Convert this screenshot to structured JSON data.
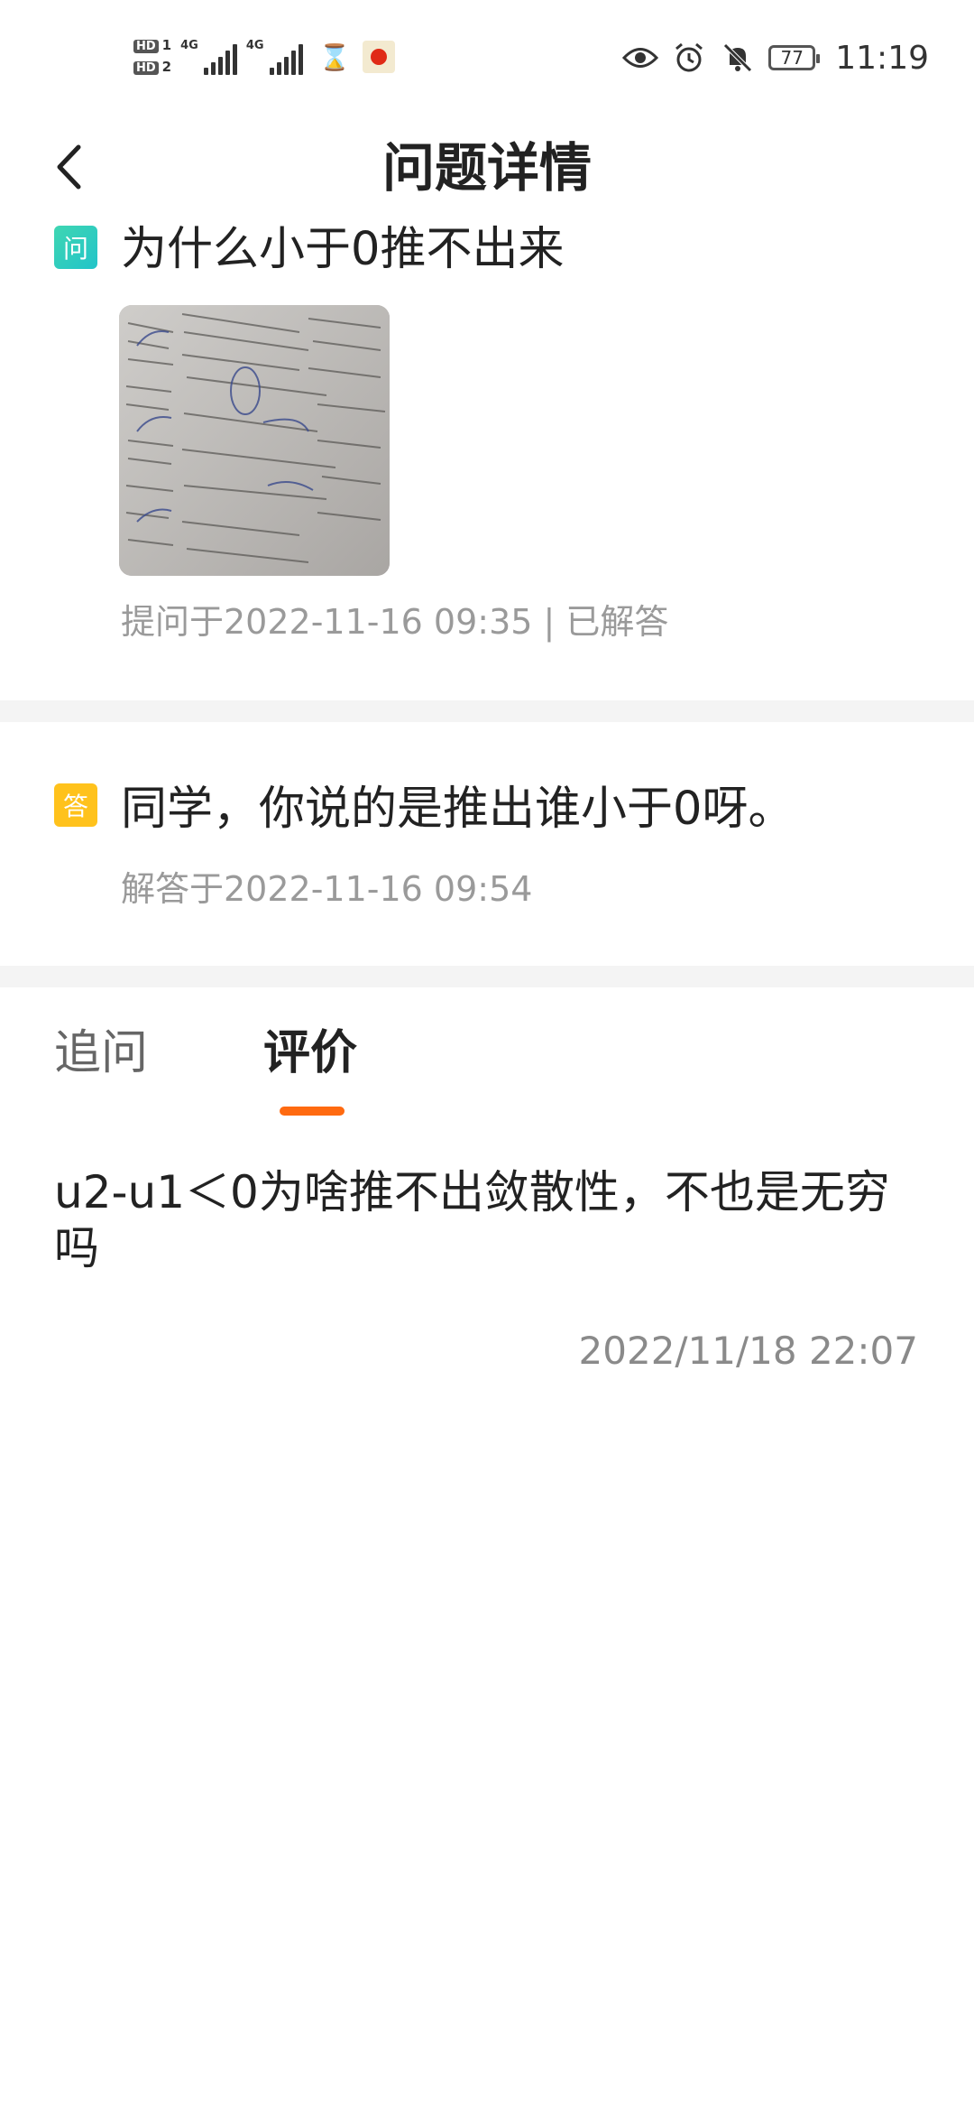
{
  "status_bar": {
    "hd1": "HD",
    "sim1": "1",
    "hd2": "HD",
    "sim2": "2",
    "net1": "4G",
    "net2": "4G",
    "battery": "77",
    "time": "11:19"
  },
  "header": {
    "title": "问题详情"
  },
  "question": {
    "tag": "问",
    "text": "为什么小于0推不出来",
    "meta": "提问于2022-11-16 09:35 | 已解答"
  },
  "answer": {
    "tag": "答",
    "text": "同学，你说的是推出谁小于0呀。",
    "meta": "解答于2022-11-16 09:54"
  },
  "tabs": [
    {
      "label": "追问"
    },
    {
      "label": "评价",
      "selected": true
    }
  ],
  "review": {
    "text": "u2-u1＜0为啥推不出敛散性，不也是无穷吗",
    "time": "2022/11/18 22:07"
  },
  "colors": {
    "accent": "#ff6a10",
    "question_tag": "#22c4c9",
    "answer_tag": "#ffc21c"
  }
}
